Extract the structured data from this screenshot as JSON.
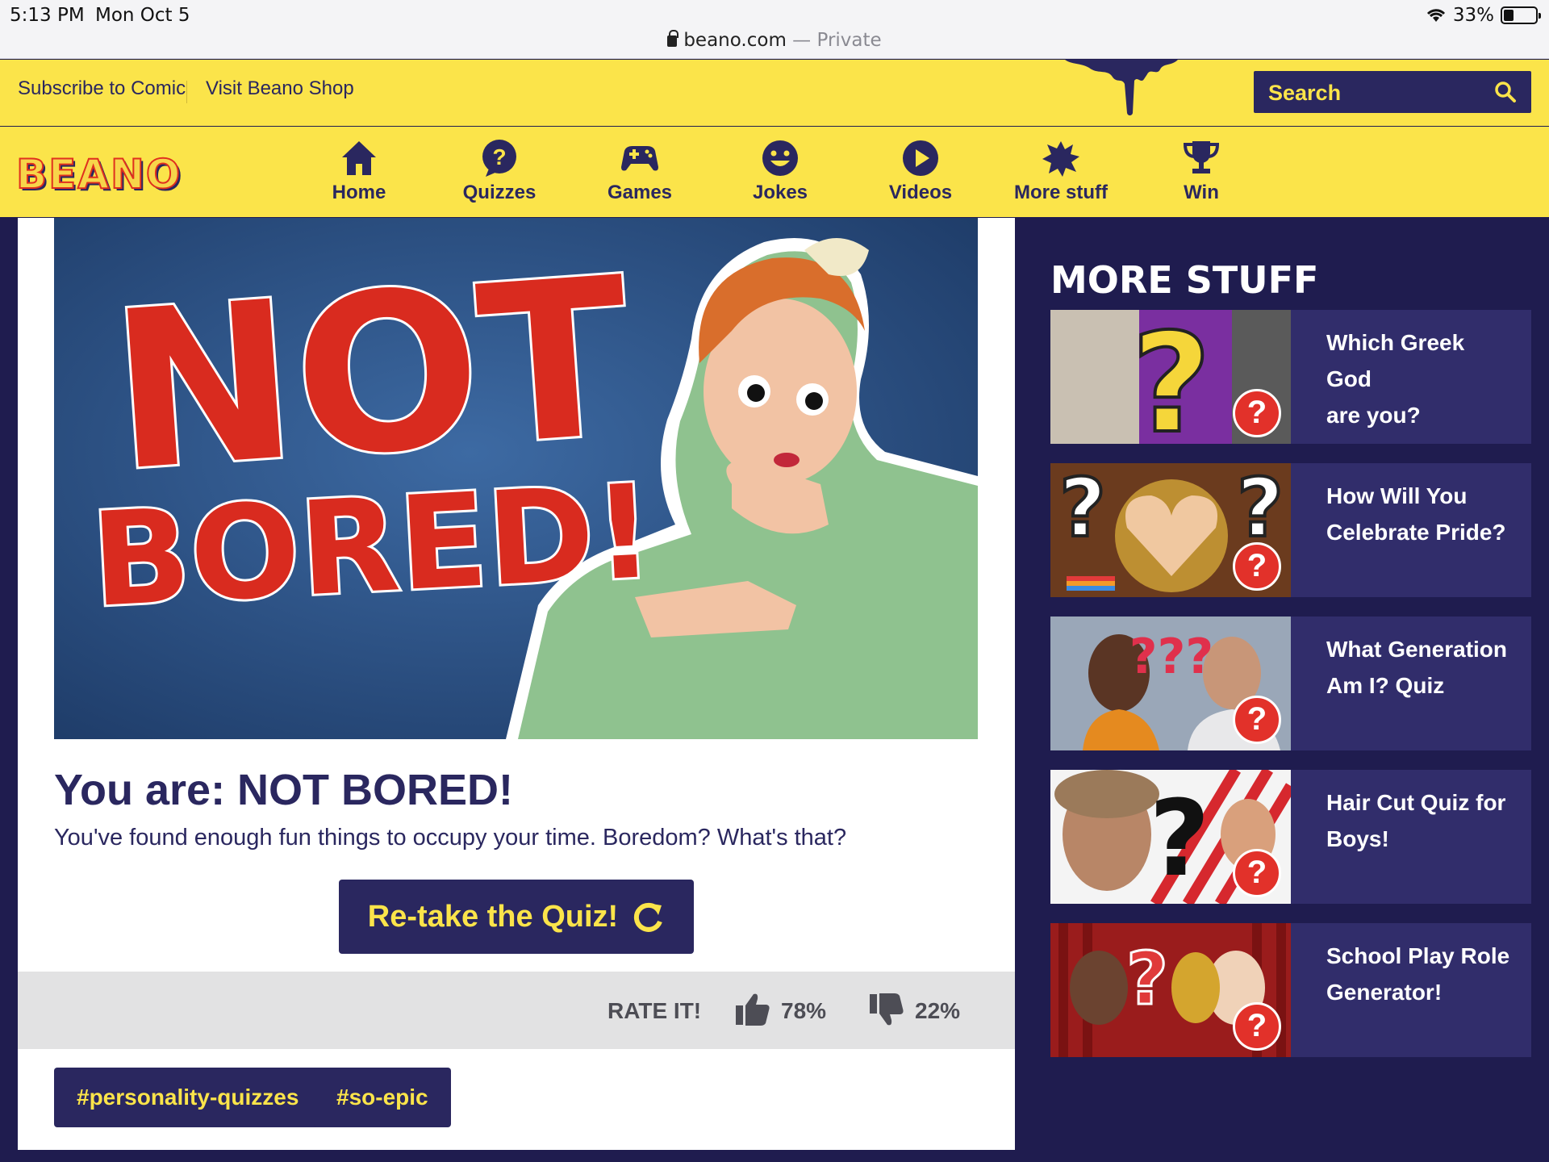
{
  "status": {
    "time": "5:13 PM",
    "date": "Mon Oct 5",
    "battery": "33%"
  },
  "browser": {
    "url": "beano.com",
    "separator": "—",
    "mode": "Private"
  },
  "util": {
    "subscribe": "Subscribe to Comic",
    "shop": "Visit Beano Shop"
  },
  "search": {
    "label": "Search"
  },
  "logo": "BEANO",
  "nav": [
    {
      "label": "Home",
      "icon": "home-icon"
    },
    {
      "label": "Quizzes",
      "icon": "question-bubble-icon"
    },
    {
      "label": "Games",
      "icon": "gamepad-icon"
    },
    {
      "label": "Jokes",
      "icon": "smiley-icon"
    },
    {
      "label": "Videos",
      "icon": "play-icon"
    },
    {
      "label": "More stuff",
      "icon": "splat-icon"
    },
    {
      "label": "Win",
      "icon": "trophy-icon"
    }
  ],
  "hero": {
    "text_line1": "NOT",
    "text_line2": "BORED!"
  },
  "result": {
    "title": "You are: NOT BORED!",
    "description": "You've found enough fun things to occupy your time. Boredom? What's that?",
    "retake_label": "Re-take the Quiz!"
  },
  "rating": {
    "label": "RATE IT!",
    "up": "78%",
    "down": "22%"
  },
  "tags": [
    "#personality-quizzes",
    "#so-epic"
  ],
  "sidebar": {
    "title": "MORE STUFF",
    "items": [
      {
        "line1": "Which Greek God",
        "line2": "are you?"
      },
      {
        "line1": "How Will You",
        "line2": "Celebrate Pride?"
      },
      {
        "line1": "What Generation",
        "line2": "Am I? Quiz"
      },
      {
        "line1": "Hair Cut Quiz for",
        "line2": "Boys!"
      },
      {
        "line1": "School Play Role",
        "line2": "Generator!"
      }
    ],
    "badge": "?"
  },
  "colors": {
    "yellow": "#fbe44a",
    "navy": "#2a275f",
    "page_bg": "#1f1c4f",
    "red": "#e2312a"
  }
}
